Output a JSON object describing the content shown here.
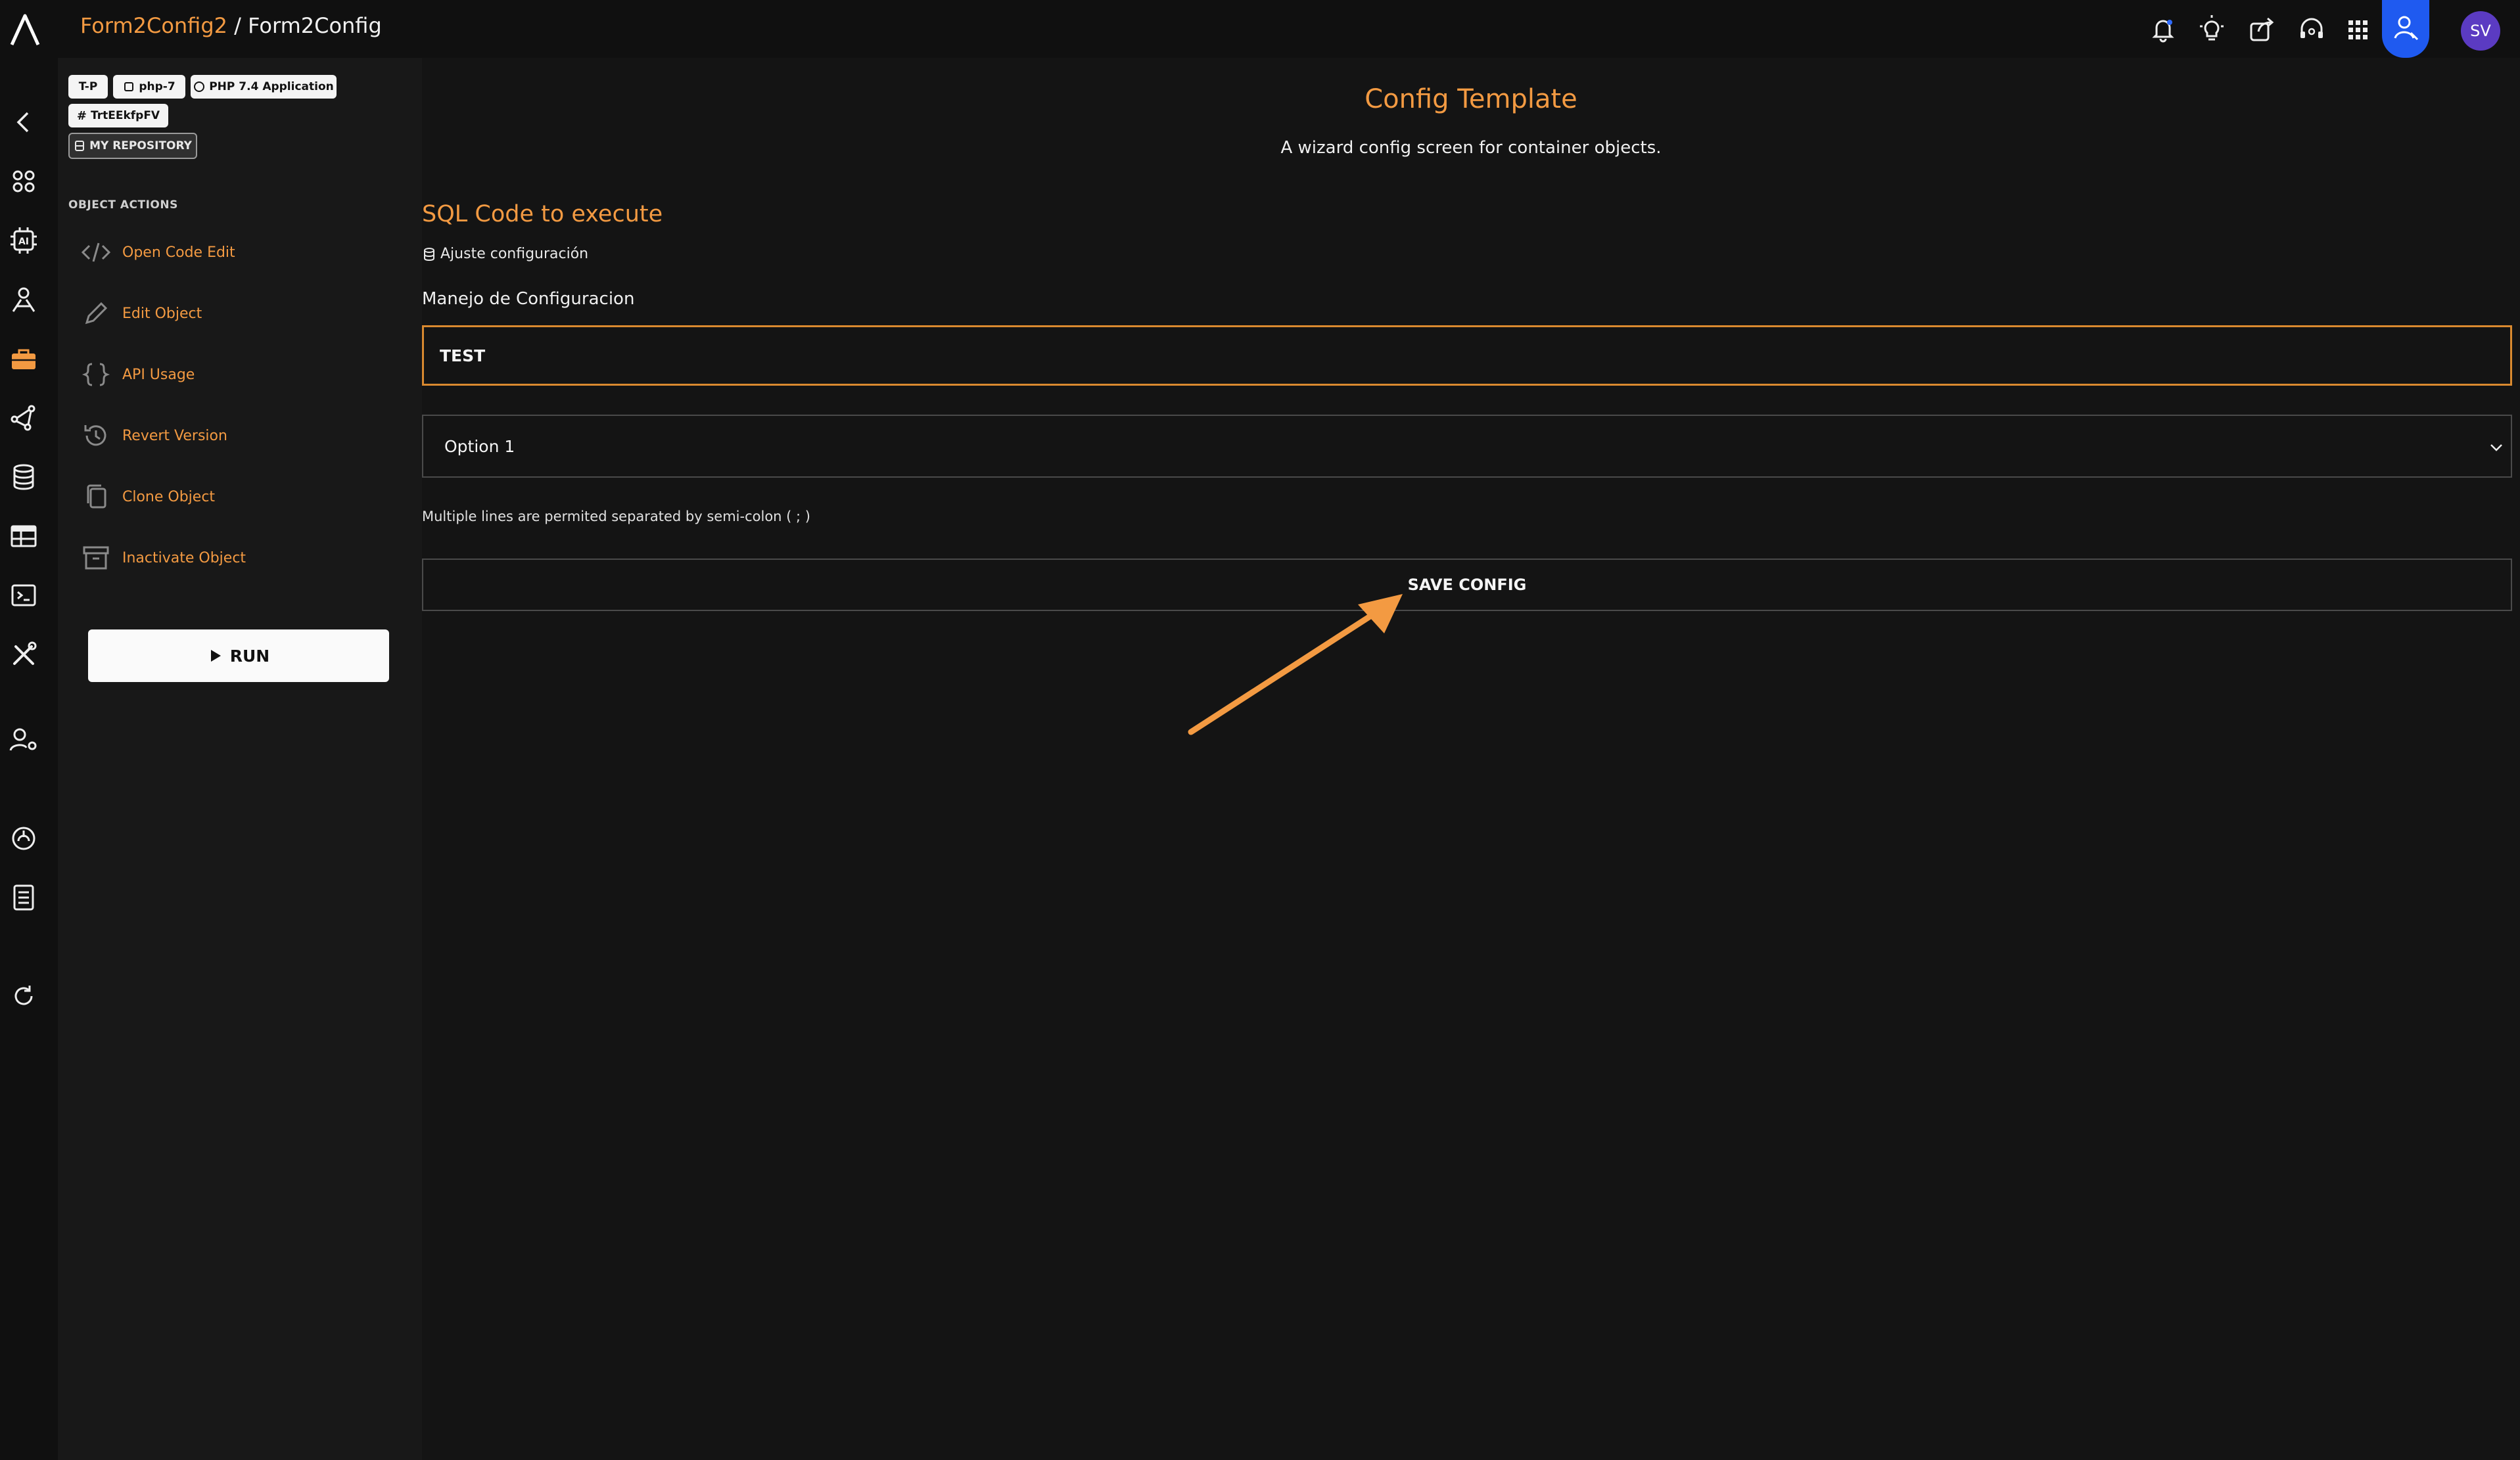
{
  "header": {
    "breadcrumb_parent": "Form2Config2",
    "breadcrumb_separator": " / ",
    "breadcrumb_current": "Form2Config",
    "icons": [
      "bell-icon",
      "lightbulb-icon",
      "share-icon",
      "support-icon",
      "apps-grid-icon",
      "profile-icon"
    ],
    "avatar_initials": "SV",
    "accent_color": "#1f5af0"
  },
  "sidebar": {
    "tags": {
      "t1": "T-P",
      "t2": "php-7",
      "t3": "PHP 7.4 Application",
      "t4": "TrtEEkfpFV",
      "t5": "MY REPOSITORY"
    },
    "actions_heading": "OBJECT ACTIONS",
    "actions": [
      {
        "label": "Open Code Edit",
        "icon": "code-icon"
      },
      {
        "label": "Edit Object",
        "icon": "pencil-icon"
      },
      {
        "label": "API Usage",
        "icon": "braces-icon"
      },
      {
        "label": "Revert Version",
        "icon": "history-icon"
      },
      {
        "label": "Clone Object",
        "icon": "copy-icon"
      },
      {
        "label": "Inactivate Object",
        "icon": "archive-icon"
      }
    ],
    "run_label": "RUN"
  },
  "main": {
    "title": "Config Template",
    "subtitle": "A wizard config screen for container objects.",
    "section_title": "SQL Code to execute",
    "config_hint": "Ajuste configuración",
    "field_label": "Manejo de Configuracion",
    "input_value": "TEST",
    "select_value": "Option 1",
    "help_text": "Multiple lines are permited separated by semi-colon ( ; )",
    "save_label": "SAVE CONFIG"
  },
  "colors": {
    "accent_orange": "#f39a42",
    "background": "#141414",
    "sidebar": "#181818"
  }
}
